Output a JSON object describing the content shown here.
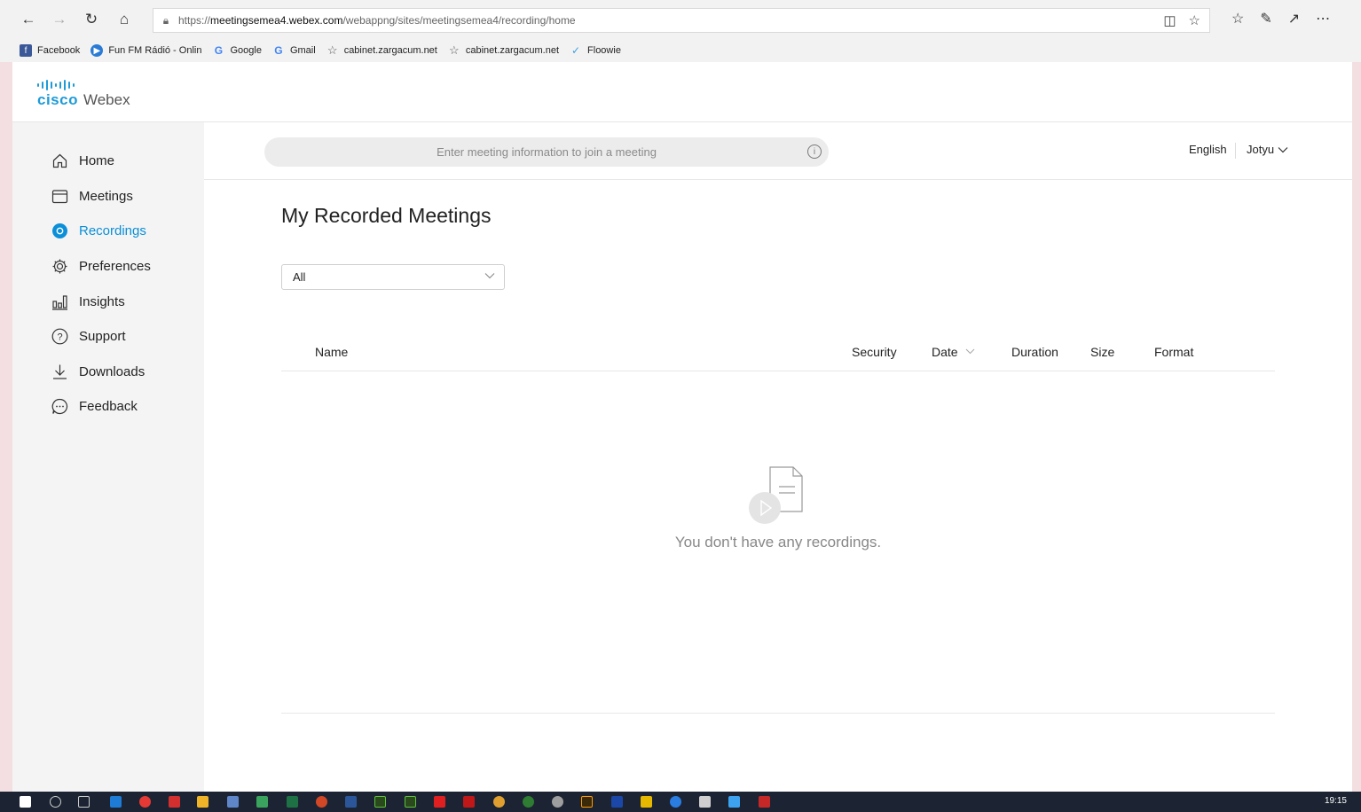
{
  "browser": {
    "url_prefix": "https://",
    "url_host": "meetingsemea4.webex.com",
    "url_path": "/webappng/sites/meetingsemea4/recording/home",
    "favorites": [
      {
        "label": "Facebook",
        "icon": "facebook-icon",
        "color": "#3b5998"
      },
      {
        "label": "Fun FM Rádió - Onlin",
        "icon": "play-circle-icon",
        "color": "#2b7bd6"
      },
      {
        "label": "Google",
        "icon": "google-icon",
        "color": "#4285f4"
      },
      {
        "label": "Gmail",
        "icon": "google-icon",
        "color": "#4285f4"
      },
      {
        "label": "cabinet.zargacum.net",
        "icon": "star-icon",
        "color": "#555555"
      },
      {
        "label": "cabinet.zargacum.net",
        "icon": "star-icon",
        "color": "#555555"
      },
      {
        "label": "Floowie",
        "icon": "floowie-icon",
        "color": "#3aa0e0"
      }
    ]
  },
  "app": {
    "brand_cisco": "cisco",
    "brand_webex": "Webex",
    "accent": "#0a8fd8"
  },
  "sidebar": {
    "items": [
      {
        "label": "Home",
        "icon": "home-icon"
      },
      {
        "label": "Meetings",
        "icon": "calendar-icon"
      },
      {
        "label": "Recordings",
        "icon": "recording-icon",
        "active": true
      },
      {
        "label": "Preferences",
        "icon": "gear-icon"
      },
      {
        "label": "Insights",
        "icon": "insights-icon"
      },
      {
        "label": "Support",
        "icon": "help-icon"
      },
      {
        "label": "Downloads",
        "icon": "download-icon"
      },
      {
        "label": "Feedback",
        "icon": "chat-icon"
      }
    ]
  },
  "header": {
    "join_placeholder": "Enter meeting information to join a meeting",
    "language": "English",
    "user": "Jotyu"
  },
  "main": {
    "title": "My Recorded Meetings",
    "filter_value": "All",
    "columns": {
      "name": "Name",
      "security": "Security",
      "date": "Date",
      "duration": "Duration",
      "size": "Size",
      "format": "Format"
    },
    "empty_message": "You don't have any recordings."
  },
  "taskbar": {
    "clock": "19:15"
  }
}
